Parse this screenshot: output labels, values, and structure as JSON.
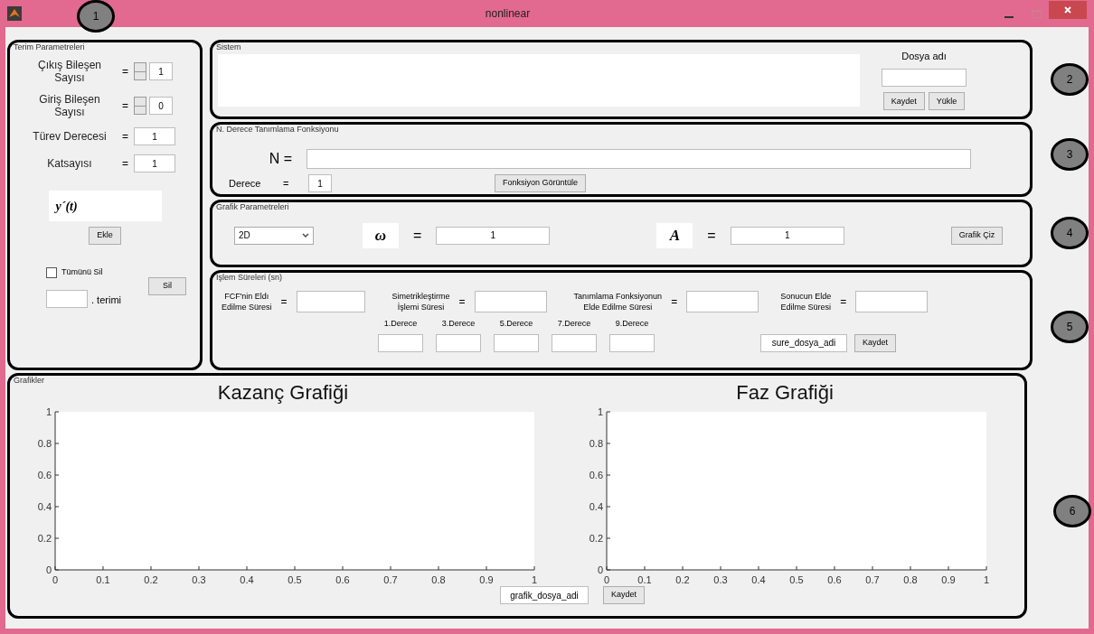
{
  "window": {
    "title": "nonlinear"
  },
  "annotations": [
    "1",
    "2",
    "3",
    "4",
    "5",
    "6"
  ],
  "terim_parametreleri": {
    "title": "Terim Parametreleri",
    "rows": [
      {
        "kind": "spinner",
        "label": "Çıkış Bileşen Sayısı",
        "equals": "=",
        "value": "1"
      },
      {
        "kind": "spinner",
        "label": "Giriş Bileşen Sayısı",
        "equals": "=",
        "value": "0"
      },
      {
        "kind": "field",
        "label": "Türev Derecesi",
        "equals": "=",
        "value": "1"
      },
      {
        "kind": "field",
        "label": "Katsayısı",
        "equals": "=",
        "value": "1"
      }
    ],
    "preview": "y´(t)",
    "add_button": "Ekle",
    "clear_all": {
      "label": "Tümünü Sil",
      "checked": false
    },
    "delete_button": "Sil",
    "term_suffix": ". terimi"
  },
  "sistem": {
    "title": "Sistem",
    "file_label": "Dosya adı",
    "buttons": [
      "Kaydet",
      "Yükle"
    ]
  },
  "fonksiyon": {
    "title": "N. Derece Tanımlama Fonksiyonu",
    "n_label": "N =",
    "degree_label": "Derece",
    "equals": "=",
    "degree": "1",
    "button": "Fonksiyon Görüntüle"
  },
  "grafik_parametreleri": {
    "title": "Grafik Parametreleri",
    "mode": "2D",
    "omega": {
      "symbol": "ω",
      "equals": "=",
      "value": "1"
    },
    "amplitude": {
      "symbol": "A",
      "equals": "=",
      "value": "1"
    },
    "button": "Grafik Çiz"
  },
  "islem_sureleri": {
    "title": "İşlem Süreleri (sn)",
    "times": [
      {
        "lines": [
          "FCF'nin Eldı",
          "Edilme Süresi"
        ],
        "equals": "="
      },
      {
        "lines": [
          "Simetrikleştirme",
          "İşlemi Süresi"
        ],
        "equals": "="
      },
      {
        "lines": [
          "Tanımlama Fonksiyonun",
          "Elde Edilme Süresi"
        ],
        "equals": "="
      },
      {
        "lines": [
          "Sonucun Elde",
          "Edilme Süresi"
        ],
        "equals": "="
      }
    ],
    "degrees": [
      "1.Derece",
      "3.Derece",
      "5.Derece",
      "7.Derece",
      "9.Derece"
    ],
    "file_value": "sure_dosya_adi",
    "button": "Kaydet"
  },
  "grafikler": {
    "title": "Grafikler",
    "file_value": "grafik_dosya_adi",
    "button": "Kaydet",
    "charts": [
      {
        "chart_data": {
          "type": "line",
          "title": "Kazanç Grafiği",
          "xlim": [
            0,
            1
          ],
          "ylim": [
            0,
            1
          ],
          "xticks": [
            0,
            0.1,
            0.2,
            0.3,
            0.4,
            0.5,
            0.6,
            0.7,
            0.8,
            0.9,
            1
          ],
          "yticks": [
            0,
            0.2,
            0.4,
            0.6,
            0.8,
            1
          ]
        }
      },
      {
        "chart_data": {
          "type": "line",
          "title": "Faz Grafiği",
          "xlim": [
            0,
            1
          ],
          "ylim": [
            0,
            1
          ],
          "xticks": [
            0,
            0.1,
            0.2,
            0.3,
            0.4,
            0.5,
            0.6,
            0.7,
            0.8,
            0.9,
            1
          ],
          "yticks": [
            0,
            0.2,
            0.4,
            0.6,
            0.8,
            1
          ]
        }
      }
    ]
  }
}
